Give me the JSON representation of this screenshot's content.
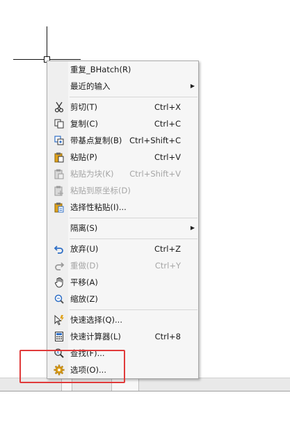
{
  "menu": {
    "items": [
      {
        "label": "重复_BHatch(R)",
        "shortcut": "",
        "submenu": false,
        "disabled": false,
        "icon": "none"
      },
      {
        "label": "最近的输入",
        "shortcut": "",
        "submenu": true,
        "disabled": false,
        "icon": "none"
      },
      {
        "label": "剪切(T)",
        "shortcut": "Ctrl+X",
        "submenu": false,
        "disabled": false,
        "icon": "scissors-icon"
      },
      {
        "label": "复制(C)",
        "shortcut": "Ctrl+C",
        "submenu": false,
        "disabled": false,
        "icon": "copy-icon"
      },
      {
        "label": "带基点复制(B)",
        "shortcut": "Ctrl+Shift+C",
        "submenu": false,
        "disabled": false,
        "icon": "copy-basepoint-icon"
      },
      {
        "label": "粘贴(P)",
        "shortcut": "Ctrl+V",
        "submenu": false,
        "disabled": false,
        "icon": "paste-icon"
      },
      {
        "label": "粘贴为块(K)",
        "shortcut": "Ctrl+Shift+V",
        "submenu": false,
        "disabled": true,
        "icon": "paste-block-icon"
      },
      {
        "label": "粘贴到原坐标(D)",
        "shortcut": "",
        "submenu": false,
        "disabled": true,
        "icon": "paste-original-icon"
      },
      {
        "label": "选择性粘贴(I)...",
        "shortcut": "",
        "submenu": false,
        "disabled": false,
        "icon": "paste-special-icon"
      },
      {
        "label": "隔离(S)",
        "shortcut": "",
        "submenu": true,
        "disabled": false,
        "icon": "none"
      },
      {
        "label": "放弃(U)",
        "shortcut": "Ctrl+Z",
        "submenu": false,
        "disabled": false,
        "icon": "undo-icon"
      },
      {
        "label": "重做(D)",
        "shortcut": "Ctrl+Y",
        "submenu": false,
        "disabled": true,
        "icon": "redo-icon"
      },
      {
        "label": "平移(A)",
        "shortcut": "",
        "submenu": false,
        "disabled": false,
        "icon": "pan-hand-icon"
      },
      {
        "label": "缩放(Z)",
        "shortcut": "",
        "submenu": false,
        "disabled": false,
        "icon": "zoom-icon"
      },
      {
        "label": "快速选择(Q)...",
        "shortcut": "",
        "submenu": false,
        "disabled": false,
        "icon": "quick-select-icon"
      },
      {
        "label": "快速计算器(L)",
        "shortcut": "Ctrl+8",
        "submenu": false,
        "disabled": false,
        "icon": "calculator-icon"
      },
      {
        "label": "查找(F)...",
        "shortcut": "",
        "submenu": false,
        "disabled": false,
        "icon": "find-icon"
      },
      {
        "label": "选项(O)...",
        "shortcut": "",
        "submenu": false,
        "disabled": false,
        "icon": "options-gear-icon"
      }
    ]
  },
  "colors": {
    "menu_bg": "#f6f6f6",
    "highlight": "#e03a3a",
    "disabled_text": "#a6a6a6",
    "icon_blue": "#2f6fc6",
    "icon_gold": "#e0a21a"
  }
}
